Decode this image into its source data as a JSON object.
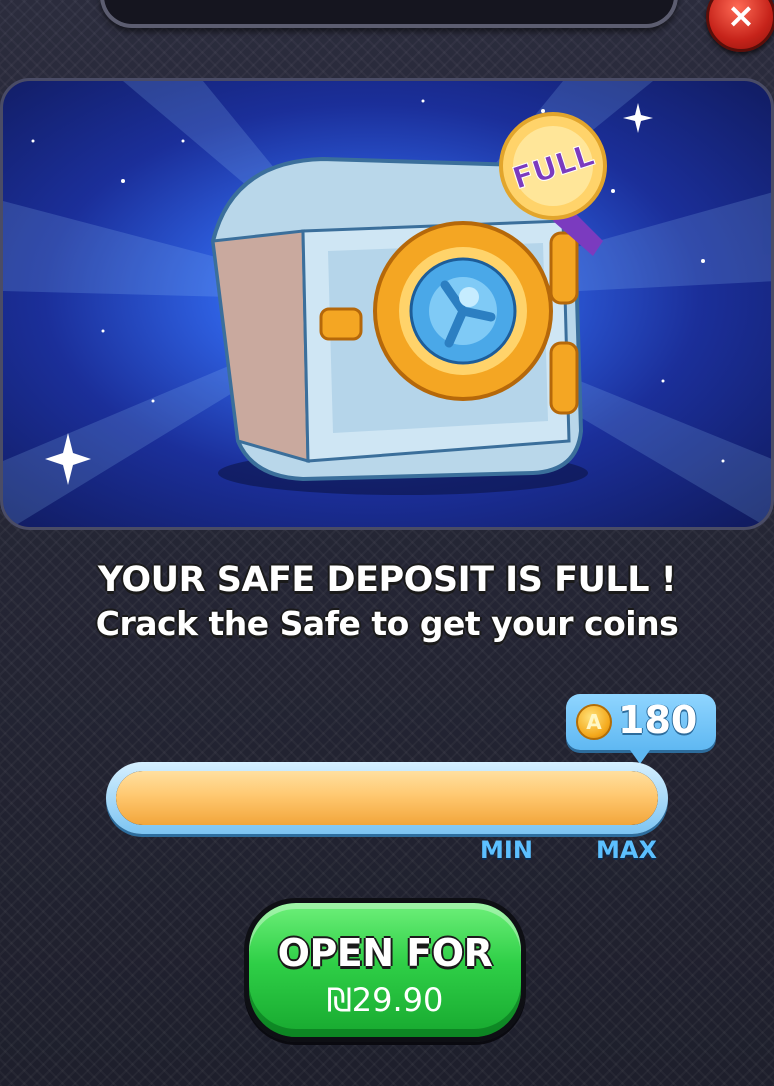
{
  "header": {
    "close_label": "×"
  },
  "banner": {
    "badge_label": "FULL"
  },
  "message": {
    "headline": "YOUR SAFE DEPOSIT IS FULL !",
    "subline": "Crack the Safe to get your coins"
  },
  "coins": {
    "icon_letter": "A",
    "amount": "180"
  },
  "progress": {
    "fill_fraction": 1.0,
    "min_label": "MIN",
    "max_label": "MAX"
  },
  "open_button": {
    "label": "OPEN FOR",
    "price": "₪29.90"
  },
  "colors": {
    "accent_green": "#2fcf47",
    "bar_orange": "#ffc870",
    "bubble_blue": "#6fc2f5",
    "close_red": "#c6231a"
  }
}
